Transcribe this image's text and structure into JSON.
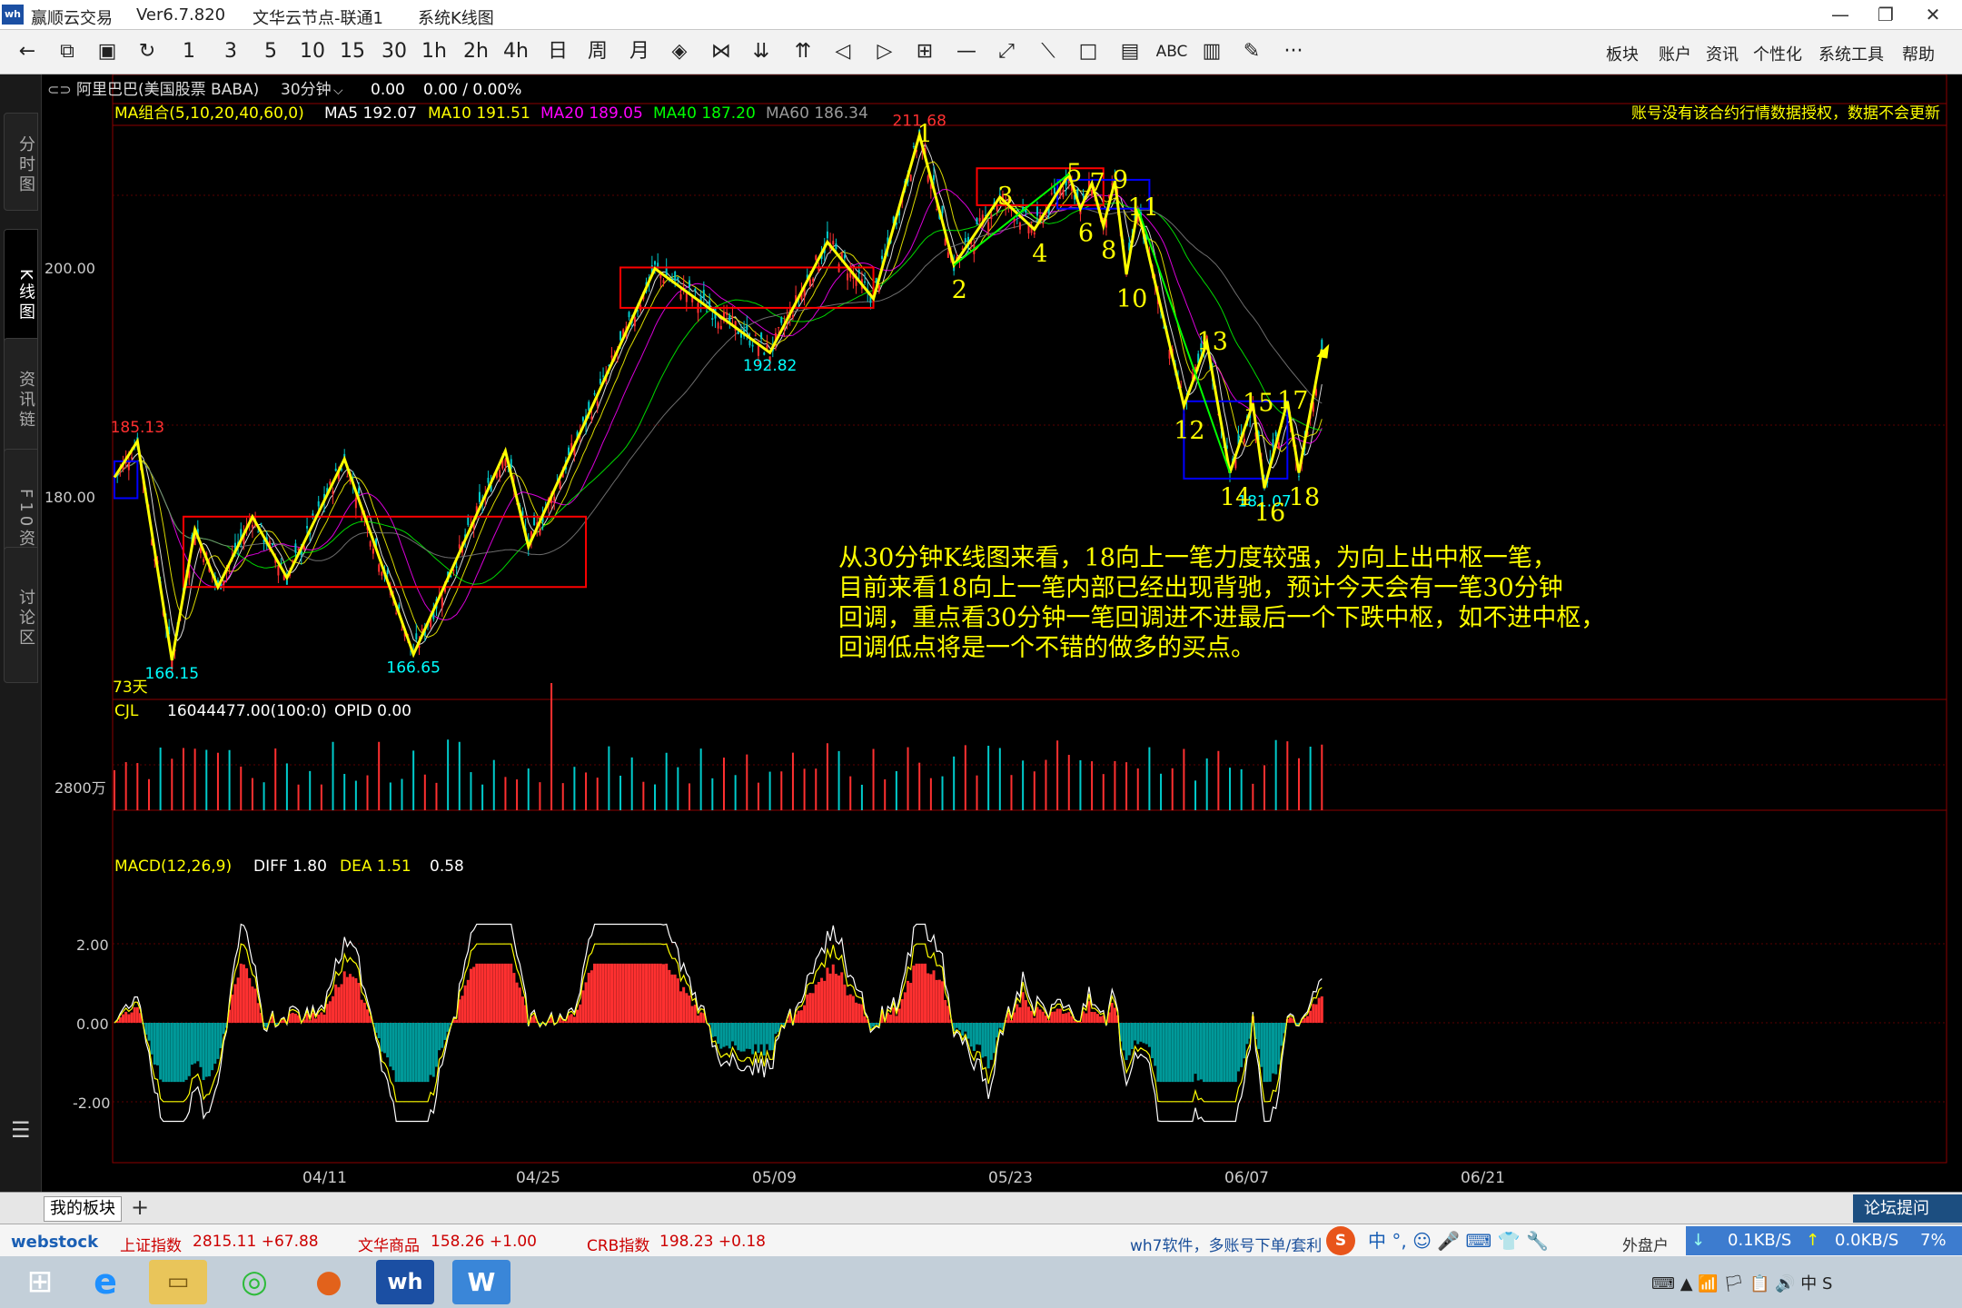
{
  "window": {
    "app_name": "赢顺云交易",
    "version": "Ver6.7.820",
    "server": "文华云节点-联通1",
    "view": "系统K线图",
    "controls": [
      "—",
      "❐",
      "✕"
    ]
  },
  "toolbar": {
    "items": [
      "←",
      "⧉",
      "▣",
      "↻",
      "1",
      "3",
      "5",
      "10",
      "15",
      "30",
      "1h",
      "2h",
      "4h",
      "日",
      "周",
      "月",
      "◈",
      "⋈",
      "⇊",
      "⇈",
      "◁",
      "▷",
      "⊞",
      "—",
      "⤢",
      "⟍",
      "□",
      "▤",
      "ABC",
      "▥",
      "✎",
      "···"
    ],
    "menus": [
      "板块",
      "账户",
      "资讯",
      "个性化",
      "系统工具",
      "帮助"
    ]
  },
  "side_nav": [
    "分时图",
    "K线图",
    "资讯链",
    "F10资料",
    "讨论区"
  ],
  "chart_header": {
    "symbol": "阿里巴巴(美国股票 BABA)",
    "period": "30分钟",
    "price": "0.00",
    "change": "0.00 / 0.00%",
    "ma_label": "MA组合(5,10,20,40,60,0)",
    "ma5": "MA5 192.07",
    "ma10": "MA10 191.51",
    "ma20": "MA20 189.05",
    "ma40": "MA40 187.20",
    "ma60": "MA60 186.34",
    "notice": "账号没有该合约行情数据授权，数据不会更新",
    "days_label": "73天"
  },
  "colors": {
    "ma5": "#ffffff",
    "ma10": "#ffff00",
    "ma20": "#ff00ff",
    "ma40": "#00ff00",
    "ma60": "#808080",
    "up": "#ff3030",
    "down": "#00cccc",
    "stroke": "#ffff00",
    "label_high": "#ff3030",
    "label_low": "#00ffff",
    "zs_red": "#ff0000",
    "zs_blue": "#0000ff",
    "segment": "#00ff00"
  },
  "annotation": "从30分钟K线图来看，18向上一笔力度较强，为向上出中枢一笔，\n目前来看18向上一笔内部已经出现背驰，预计今天会有一笔30分钟\n回调，重点看30分钟一笔回调进不进最后一个下跌中枢，如不进中枢，\n回调低点将是一个不错的做多的买点。",
  "volume": {
    "label": "CJL",
    "value": "16044477.00(100:0)",
    "opid": "OPID 0.00",
    "axis_label": "2800万"
  },
  "macd": {
    "label": "MACD(12,26,9)",
    "diff": "DIFF 1.80",
    "dea": "DEA 1.51",
    "macd": "0.58",
    "axis": [
      "2.00",
      "0.00",
      "-2.00"
    ]
  },
  "chart_data": {
    "type": "candlestick",
    "period": "30分钟",
    "price_axis": {
      "ticks": [
        "200.00",
        "180.00"
      ],
      "ylim": [
        166.0,
        212.0
      ]
    },
    "x_dates": [
      "04/11",
      "04/25",
      "05/09",
      "05/23",
      "06/07",
      "06/21"
    ],
    "strokes": [
      {
        "x": 0,
        "y": 182
      },
      {
        "x": 2,
        "y": 185.13
      },
      {
        "x": 5,
        "y": 166.15
      },
      {
        "x": 7,
        "y": 177.5
      },
      {
        "x": 9,
        "y": 172.5
      },
      {
        "x": 12,
        "y": 178.6
      },
      {
        "x": 15,
        "y": 173.3
      },
      {
        "x": 20,
        "y": 183.6
      },
      {
        "x": 26,
        "y": 166.65
      },
      {
        "x": 34,
        "y": 184.3
      },
      {
        "x": 36,
        "y": 176
      },
      {
        "x": 47,
        "y": 200.1
      },
      {
        "x": 57,
        "y": 192.82
      },
      {
        "x": 62,
        "y": 202.4
      },
      {
        "x": 66,
        "y": 197.5
      },
      {
        "x": 70,
        "y": 211.68
      },
      {
        "x": 73,
        "y": 200.4
      },
      {
        "x": 77,
        "y": 206.3
      },
      {
        "x": 80,
        "y": 203.5
      },
      {
        "x": 83,
        "y": 208.3
      },
      {
        "x": 84,
        "y": 205.3
      },
      {
        "x": 85,
        "y": 207.5
      },
      {
        "x": 86,
        "y": 203.8
      },
      {
        "x": 87,
        "y": 207.7
      },
      {
        "x": 88,
        "y": 199.6
      },
      {
        "x": 89,
        "y": 205.3
      },
      {
        "x": 93,
        "y": 188.2
      },
      {
        "x": 95,
        "y": 193.7
      },
      {
        "x": 97,
        "y": 182.4
      },
      {
        "x": 99,
        "y": 188.4
      },
      {
        "x": 100,
        "y": 181.07
      },
      {
        "x": 102,
        "y": 188.6
      },
      {
        "x": 103,
        "y": 182.4
      },
      {
        "x": 105,
        "y": 193.1
      }
    ],
    "stroke_labels": [
      {
        "t": "185.13",
        "x": 2,
        "y": 185.13,
        "kind": "high"
      },
      {
        "t": "166.15",
        "x": 5,
        "y": 166.15,
        "kind": "low"
      },
      {
        "t": "166.65",
        "x": 26,
        "y": 166.65,
        "kind": "low"
      },
      {
        "t": "192.82",
        "x": 57,
        "y": 192.82,
        "kind": "low"
      },
      {
        "t": "211.68",
        "x": 70,
        "y": 211.68,
        "kind": "high"
      },
      {
        "t": "181.07",
        "x": 100,
        "y": 181.07,
        "kind": "low"
      }
    ],
    "point_numbers": [
      {
        "t": "1",
        "x": 70,
        "y": 211.68,
        "pos": "up"
      },
      {
        "t": "2",
        "x": 73,
        "y": 200.4,
        "pos": "down"
      },
      {
        "t": "3",
        "x": 77,
        "y": 206.3,
        "pos": "up"
      },
      {
        "t": "4",
        "x": 80,
        "y": 203.5,
        "pos": "down"
      },
      {
        "t": "5",
        "x": 83,
        "y": 208.3,
        "pos": "up"
      },
      {
        "t": "6",
        "x": 84,
        "y": 205.3,
        "pos": "down"
      },
      {
        "t": "7",
        "x": 85,
        "y": 207.5,
        "pos": "up"
      },
      {
        "t": "8",
        "x": 86,
        "y": 203.8,
        "pos": "down"
      },
      {
        "t": "9",
        "x": 87,
        "y": 207.7,
        "pos": "up"
      },
      {
        "t": "10",
        "x": 88,
        "y": 199.6,
        "pos": "down"
      },
      {
        "t": "11",
        "x": 89,
        "y": 205.3,
        "pos": "up"
      },
      {
        "t": "12",
        "x": 93,
        "y": 188.2,
        "pos": "down"
      },
      {
        "t": "13",
        "x": 95,
        "y": 193.7,
        "pos": "up"
      },
      {
        "t": "14",
        "x": 97,
        "y": 182.4,
        "pos": "down"
      },
      {
        "t": "15",
        "x": 99,
        "y": 188.4,
        "pos": "up"
      },
      {
        "t": "16",
        "x": 100,
        "y": 181.07,
        "pos": "down"
      },
      {
        "t": "17",
        "x": 102,
        "y": 188.6,
        "pos": "up"
      },
      {
        "t": "18",
        "x": 103,
        "y": 182.4,
        "pos": "down"
      }
    ],
    "pivots": [
      {
        "x0": 6,
        "x1": 41,
        "y0": 172.5,
        "y1": 178.6,
        "color": "red"
      },
      {
        "x0": 44,
        "x1": 66,
        "y0": 196.7,
        "y1": 200.2,
        "color": "red"
      },
      {
        "x0": 75,
        "x1": 86,
        "y0": 205.6,
        "y1": 208.8,
        "color": "red"
      },
      {
        "x0": 82,
        "x1": 90,
        "y0": 205.3,
        "y1": 207.8,
        "color": "blue"
      },
      {
        "x0": 93,
        "x1": 102,
        "y0": 181.9,
        "y1": 188.6,
        "color": "blue"
      },
      {
        "x0": 0,
        "x1": 2,
        "y0": 180.2,
        "y1": 183.4,
        "color": "blue"
      }
    ],
    "segments": [
      {
        "x0": 73,
        "y0": 200.4,
        "x1": 83,
        "y1": 208.3
      },
      {
        "x0": 89,
        "y0": 205.3,
        "x1": 97,
        "y1": 182.4
      }
    ]
  },
  "bottom": {
    "tab": "我的板块",
    "plus": "+",
    "forum": "论坛提问"
  },
  "status": {
    "logo": "webstock",
    "sh_name": "上证指数",
    "sh_val": "2815.11 +67.88",
    "wh_name": "文华商品",
    "wh_val": "158.26 +1.00",
    "crb_name": "CRB指数",
    "crb_val": "198.23 +0.18",
    "promo": "wh7软件，多账号下单/套利",
    "ime": "中 °, ☺ 🎤 ⌨ 👕 🔧",
    "outer": "外盘户",
    "down_speed": "0.1KB/S",
    "up_speed": "0.0KB/S",
    "cpu": "7%"
  },
  "taskbar": {
    "icons": [
      "windows-start",
      "ie",
      "explorer",
      "wechat",
      "firefox",
      "wh6",
      "wps"
    ],
    "tray": "⌨  ▲  📶 🏳 📋 🔊  中  S"
  }
}
